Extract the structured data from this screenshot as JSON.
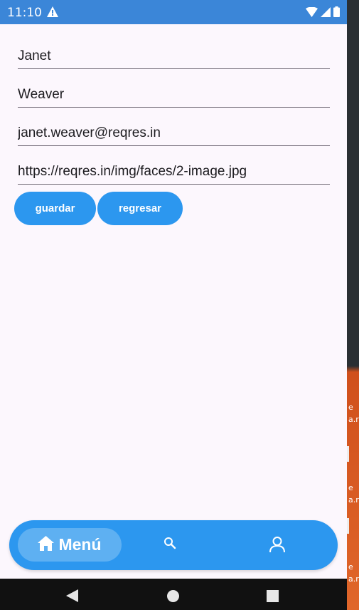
{
  "status_bar": {
    "time": "11:10"
  },
  "form": {
    "first_name": "Janet",
    "last_name": "Weaver",
    "email": "janet.weaver@reqres.in",
    "avatar_url": "https://reqres.in/img/faces/2-image.jpg"
  },
  "buttons": {
    "save_label": "guardar",
    "back_label": "regresar"
  },
  "bottom_nav": {
    "home_label": "Menú",
    "icons": [
      "home-icon",
      "search-icon",
      "user-icon"
    ]
  },
  "background_fragments": [
    "e",
    "a.r",
    "e",
    "a.r",
    "e",
    "a.r"
  ],
  "colors": {
    "status_bar": "#3b86d8",
    "primary": "#2c97ef",
    "nav_selected": "#5eb0f2",
    "surface": "#fcf7fd"
  }
}
